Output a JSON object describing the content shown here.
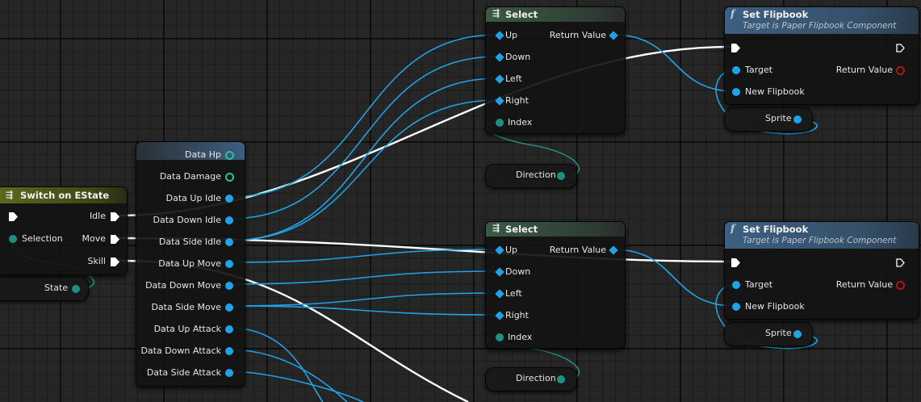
{
  "switch_node": {
    "title": "Switch on EState",
    "selection_label": "Selection",
    "outputs": [
      "Idle",
      "Move",
      "Skill"
    ]
  },
  "state_var": {
    "label": "State"
  },
  "data_node": {
    "pins": [
      "Data Hp",
      "Data Damage",
      "Data Up Idle",
      "Data Down Idle",
      "Data Side Idle",
      "Data Up Move",
      "Data Down Move",
      "Data Side Move",
      "Data Up Attack",
      "Data Down Attack",
      "Data Side Attack"
    ]
  },
  "select_nodes": [
    {
      "title": "Select",
      "inputs": [
        "Up",
        "Down",
        "Left",
        "Right",
        "Index"
      ],
      "output": "Return Value"
    },
    {
      "title": "Select",
      "inputs": [
        "Up",
        "Down",
        "Left",
        "Right",
        "Index"
      ],
      "output": "Return Value"
    }
  ],
  "direction_vars": [
    {
      "label": "Direction"
    },
    {
      "label": "Direction"
    }
  ],
  "flipbook_nodes": [
    {
      "title": "Set Flipbook",
      "subtitle": "Target is Paper Flipbook Component",
      "inputs": [
        "Target",
        "New Flipbook"
      ],
      "output": "Return Value"
    },
    {
      "title": "Set Flipbook",
      "subtitle": "Target is Paper Flipbook Component",
      "inputs": [
        "Target",
        "New Flipbook"
      ],
      "output": "Return Value"
    }
  ],
  "sprite_vars": [
    {
      "label": "Sprite"
    },
    {
      "label": "Sprite"
    }
  ],
  "colors": {
    "grid_background": "#262626",
    "exec_wire": "#ffffff",
    "object_wire": "#1ea3e6",
    "byte_wire": "#1f8f84",
    "switch_header": "#5d6b1e",
    "select_header": "#3b5a45",
    "function_header": "#3d5f80",
    "return_value_pin": "#b01515"
  },
  "icons": {
    "switch": "switch-node-icon",
    "select": "select-node-icon",
    "function": "function-f-icon"
  }
}
